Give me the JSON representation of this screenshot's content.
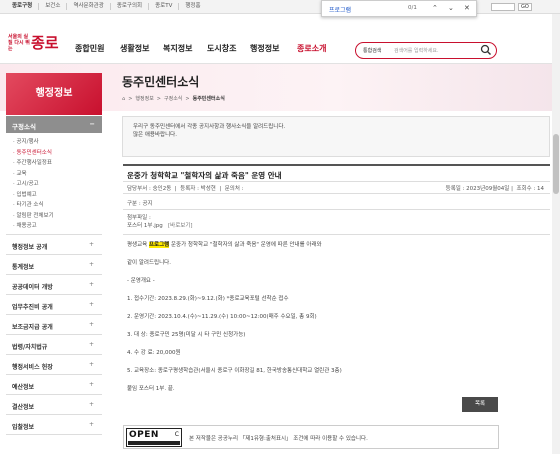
{
  "topbar": {
    "links": [
      "종로구청",
      "보건소",
      "역사문화관광",
      "종로구의회",
      "종로TV",
      "행정홈"
    ],
    "lang_go": "GO"
  },
  "findbar": {
    "query": "프로그램",
    "count": "0/1",
    "up": "⌃",
    "down": "⌄",
    "close": "✕"
  },
  "header": {
    "logo_small": "서울의 실질 다시 뛰는",
    "logo_big": "종로",
    "gnb": [
      "종합민원",
      "생활정보",
      "복지정보",
      "도시창조",
      "행정정보",
      "종로소개"
    ],
    "search_category": "통합검색",
    "search_placeholder": "검색어를 입력하세요."
  },
  "sidebar": {
    "title": "행정정보",
    "section": "구정소식",
    "section_toggle": "−",
    "sub_items": [
      "공지/행사",
      "동주민센터소식",
      "주간행사일정표",
      "교육",
      "고시/공고",
      "입법예고",
      "타기관 소식",
      "알림판 전체보기",
      "채용공고"
    ],
    "items": [
      "행정정보 공개",
      "통계정보",
      "공공데이터 개방",
      "업무추진비 공개",
      "보조금지급 공개",
      "법령/자치법규",
      "행정서비스 헌장",
      "예산정보",
      "결산정보",
      "입찰정보"
    ],
    "item_toggle": "+"
  },
  "page": {
    "title": "동주민센터소식",
    "breadcrumb": [
      "⌂",
      "행정정보",
      "구정소식",
      "동주민센터소식"
    ]
  },
  "intro": {
    "line1": "우리구 동주민센터에서 각종 공지사항과 행사소식을 알려드립니다.",
    "line2": "많은 애용바랍니다."
  },
  "post": {
    "title": "운중가 청학학교 \"철학자의 삶과 죽음\" 운영 안내",
    "author_label": "담당부서 : ",
    "author": "숭인2동",
    "writer_label": "등록자 : ",
    "writer": "박성현",
    "contact_label": "문의처 : ",
    "contact": "",
    "date_label": "등록일 : ",
    "date": "2023년09월04일",
    "views_label": "조회수 : ",
    "views": "14",
    "category_label": "구분 : ",
    "category": "공지",
    "attach_label": "첨부파일 : ",
    "attach_file": "포스터 1부.jpg",
    "attach_view": "[바로보기]",
    "body_pre": "평생교육 ",
    "body_hl": "프로그램",
    "body_post": " 운중가 청학학교 \"철학자의 삶과 죽음\" 운영에 따른 안내를 아래와",
    "body_lines": [
      "같이 알려드립니다.",
      "- 운영개요 -",
      "1. 접수기간: 2023.8.29.(화)~9.12.(화) *종로교육포털 선착순 접수",
      "2. 운영기간: 2023.10.4.(수)~11.29.(수) 10:00~12:00(매주 수요일, 총 9회)",
      "3. 대    상: 종로구민 25명(미달 시 타 구민 신청가능)",
      "4. 수 강 료: 20,000원",
      "5. 교육장소: 종로구평생학습관(서울시 종로구 이화장길 81, 한국방송통신대학교 열린관 3층)",
      "붙임 포스터 1부. 끝."
    ],
    "list_button": "목록"
  },
  "license": {
    "open": "OPEN",
    "type": "C",
    "text": "본 저작물은 공공누리 「제1유형:출처표시」 조건에 따라 이용할 수 있습니다."
  }
}
